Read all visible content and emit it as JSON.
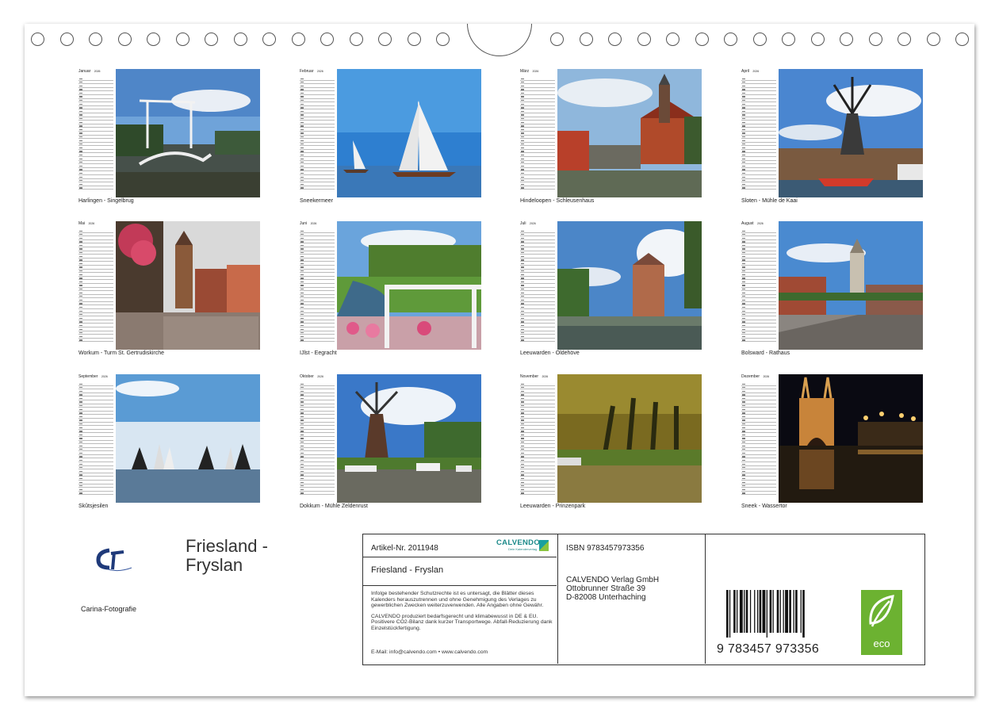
{
  "months": [
    {
      "name": "Januar",
      "year": "2026",
      "caption": "Harlingen - Singelbrug"
    },
    {
      "name": "Februar",
      "year": "2026",
      "caption": "Sneekermeer"
    },
    {
      "name": "März",
      "year": "2026",
      "caption": "Hindeloopen - Schleusenhaus"
    },
    {
      "name": "April",
      "year": "2026",
      "caption": "Sloten - Mühle de Kaai"
    },
    {
      "name": "Mai",
      "year": "2026",
      "caption": "Workum - Turm St. Gertrudiskirche"
    },
    {
      "name": "Juni",
      "year": "2026",
      "caption": "IJlst - Eegracht"
    },
    {
      "name": "Juli",
      "year": "2026",
      "caption": "Leeuwarden - Oldehöve"
    },
    {
      "name": "August",
      "year": "2026",
      "caption": "Bolsward - Rathaus"
    },
    {
      "name": "September",
      "year": "2026",
      "caption": "Skûtsjesilen"
    },
    {
      "name": "Oktober",
      "year": "2026",
      "caption": "Dokkum - Mühle Zeldenrust"
    },
    {
      "name": "November",
      "year": "2026",
      "caption": "Leeuwarden - Prinzenpark"
    },
    {
      "name": "Dezember",
      "year": "2026",
      "caption": "Sneek - Wassertor"
    }
  ],
  "info": {
    "title": "Friesland - Fryslan",
    "photographer": "Carina-Fotografie",
    "article": "Artikel-Nr. 2011948",
    "publisher_brand": "CALVENDO",
    "publisher_tagline": "Dein Kalenderverlag",
    "calendar_title": "Friesland - Fryslan",
    "legal_1": "Infolge bestehender Schutzrechte ist es untersagt, die Blätter dieses Kalenders herauszutrennen und ohne Genehmigung des Verlages zu gewerblichen Zwecken weiterzuverwenden. Alle Angaben ohne Gewähr.",
    "legal_2": "CALVENDO produziert bedarfsgerecht und klimabewusst in DE & EU. Positivere CO2-Bilanz dank kurzer Transportwege. Abfall-Reduzierung dank Einzelstückfertigung.",
    "contact": "E-Mail: info@calvendo.com • www.calvendo.com",
    "isbn": "ISBN 9783457973356",
    "publisher_name": "CALVENDO Verlag GmbH",
    "publisher_street": "Ottobrunner Straße 39",
    "publisher_city": "D-82008 Unterhaching",
    "barcode_number": "9 783457 973356",
    "eco_label": "eco"
  }
}
